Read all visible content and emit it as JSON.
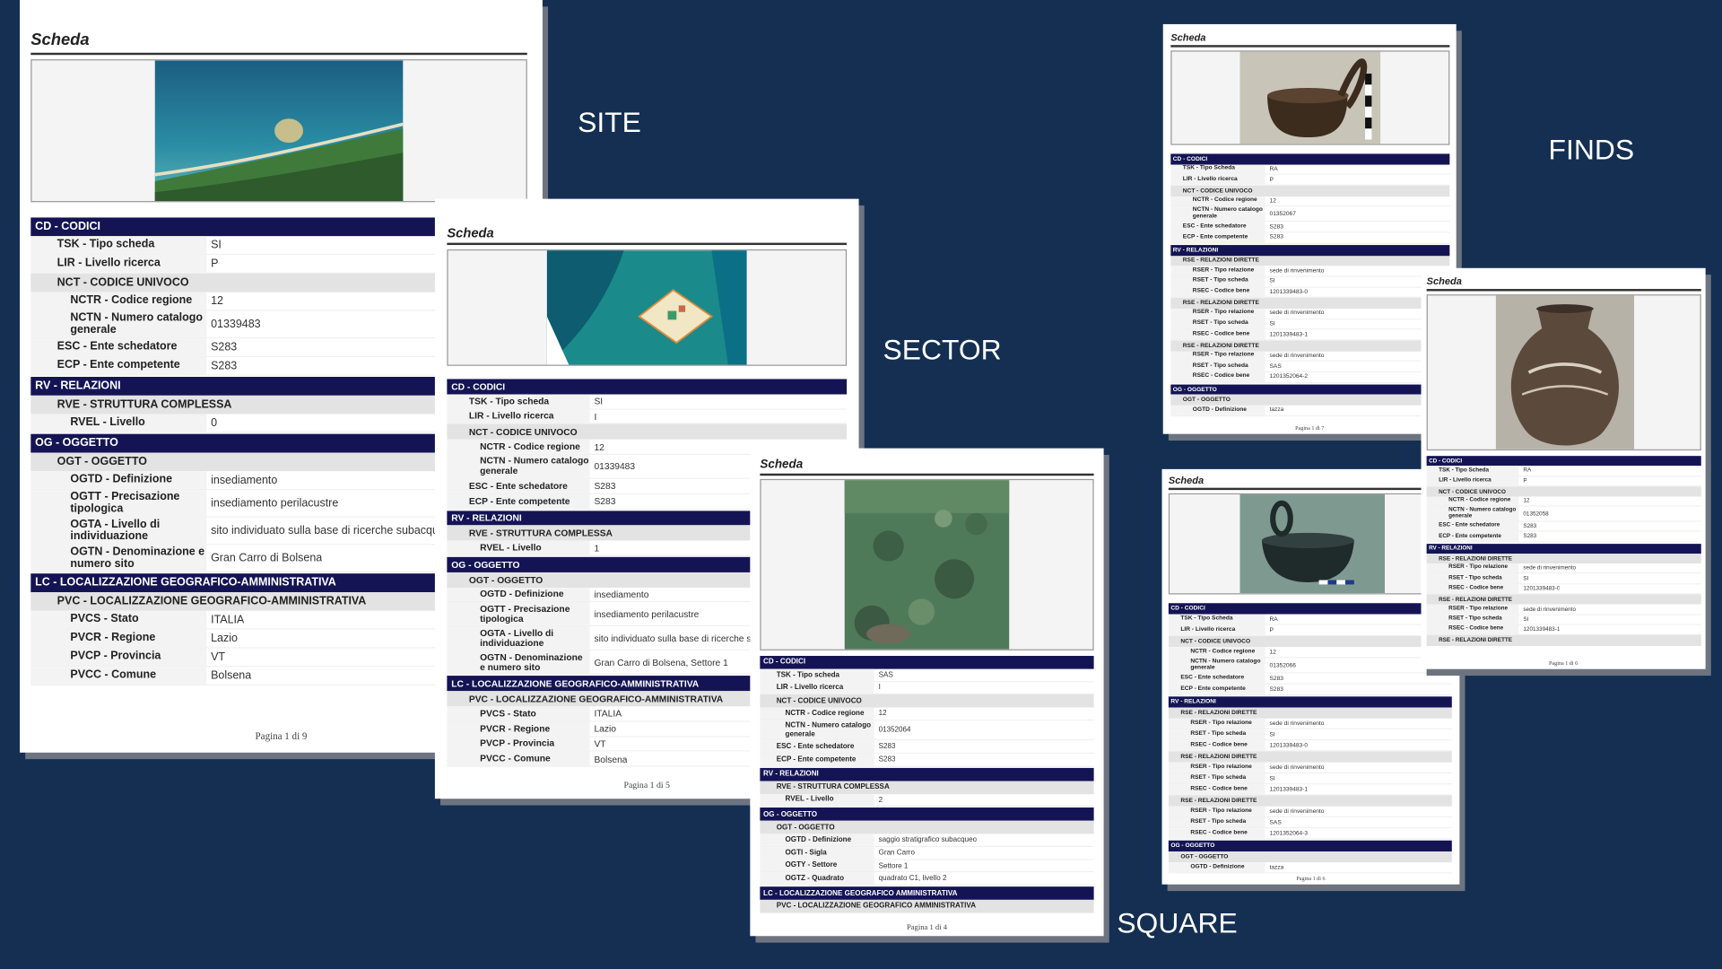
{
  "labels": {
    "site": "SITE",
    "sector": "SECTOR",
    "square": "SQUARE",
    "finds": "FINDS"
  },
  "site": {
    "title": "Scheda",
    "footer": "Pagina 1 di 9",
    "rows": [
      {
        "type": "head",
        "k": "CD - CODICI"
      },
      {
        "type": "leaf",
        "level": 1,
        "k": "TSK - Tipo scheda",
        "v": "SI"
      },
      {
        "type": "leaf",
        "level": 1,
        "k": "LIR - Livello ricerca",
        "v": "P"
      },
      {
        "type": "sub",
        "level": 1,
        "k": "NCT - CODICE UNIVOCO"
      },
      {
        "type": "leaf",
        "level": 2,
        "k": "NCTR - Codice regione",
        "v": "12"
      },
      {
        "type": "leaf",
        "level": 2,
        "k": "NCTN - Numero catalogo generale",
        "v": "01339483",
        "tall": true
      },
      {
        "type": "leaf",
        "level": 1,
        "k": "ESC - Ente schedatore",
        "v": "S283"
      },
      {
        "type": "leaf",
        "level": 1,
        "k": "ECP - Ente competente",
        "v": "S283"
      },
      {
        "type": "head",
        "k": "RV - RELAZIONI"
      },
      {
        "type": "sub",
        "level": 1,
        "k": "RVE - STRUTTURA COMPLESSA"
      },
      {
        "type": "leaf",
        "level": 2,
        "k": "RVEL - Livello",
        "v": "0"
      },
      {
        "type": "head",
        "k": "OG - OGGETTO"
      },
      {
        "type": "sub",
        "level": 1,
        "k": "OGT - OGGETTO"
      },
      {
        "type": "leaf",
        "level": 2,
        "k": "OGTD - Definizione",
        "v": "insediamento"
      },
      {
        "type": "leaf",
        "level": 2,
        "k": "OGTT - Precisazione tipologica",
        "v": "insediamento perilacustre",
        "tall": true
      },
      {
        "type": "leaf",
        "level": 2,
        "k": "OGTA - Livello di individuazione",
        "v": "sito individuato sulla base di ricerche subacque",
        "tall": true
      },
      {
        "type": "leaf",
        "level": 2,
        "k": "OGTN - Denominazione e numero sito",
        "v": "Gran Carro di Bolsena",
        "tall": true
      },
      {
        "type": "head",
        "k": "LC - LOCALIZZAZIONE GEOGRAFICO-AMMINISTRATIVA"
      },
      {
        "type": "sub",
        "level": 1,
        "k": "PVC - LOCALIZZAZIONE GEOGRAFICO-AMMINISTRATIVA"
      },
      {
        "type": "leaf",
        "level": 2,
        "k": "PVCS - Stato",
        "v": "ITALIA"
      },
      {
        "type": "leaf",
        "level": 2,
        "k": "PVCR - Regione",
        "v": "Lazio"
      },
      {
        "type": "leaf",
        "level": 2,
        "k": "PVCP - Provincia",
        "v": "VT"
      },
      {
        "type": "leaf",
        "level": 2,
        "k": "PVCC - Comune",
        "v": "Bolsena"
      }
    ]
  },
  "sector": {
    "title": "Scheda",
    "footer": "Pagina 1 di 5",
    "rows": [
      {
        "type": "head",
        "k": "CD - CODICI"
      },
      {
        "type": "leaf",
        "level": 1,
        "k": "TSK - Tipo scheda",
        "v": "SI"
      },
      {
        "type": "leaf",
        "level": 1,
        "k": "LIR - Livello ricerca",
        "v": "I"
      },
      {
        "type": "sub",
        "level": 1,
        "k": "NCT - CODICE UNIVOCO"
      },
      {
        "type": "leaf",
        "level": 2,
        "k": "NCTR - Codice regione",
        "v": "12"
      },
      {
        "type": "leaf",
        "level": 2,
        "k": "NCTN - Numero catalogo generale",
        "v": "01339483",
        "tall": true
      },
      {
        "type": "leaf",
        "level": 1,
        "k": "ESC - Ente schedatore",
        "v": "S283"
      },
      {
        "type": "leaf",
        "level": 1,
        "k": "ECP - Ente competente",
        "v": "S283"
      },
      {
        "type": "head",
        "k": "RV - RELAZIONI"
      },
      {
        "type": "sub",
        "level": 1,
        "k": "RVE - STRUTTURA COMPLESSA"
      },
      {
        "type": "leaf",
        "level": 2,
        "k": "RVEL - Livello",
        "v": "1"
      },
      {
        "type": "head",
        "k": "OG - OGGETTO"
      },
      {
        "type": "sub",
        "level": 1,
        "k": "OGT - OGGETTO"
      },
      {
        "type": "leaf",
        "level": 2,
        "k": "OGTD - Definizione",
        "v": "insediamento"
      },
      {
        "type": "leaf",
        "level": 2,
        "k": "OGTT - Precisazione tipologica",
        "v": "insediamento perilacustre",
        "tall": true
      },
      {
        "type": "leaf",
        "level": 2,
        "k": "OGTA - Livello di individuazione",
        "v": "sito individuato sulla base di ricerche sub",
        "tall": true
      },
      {
        "type": "leaf",
        "level": 2,
        "k": "OGTN - Denominazione e numero sito",
        "v": "Gran Carro di Bolsena, Settore 1",
        "tall": true
      },
      {
        "type": "head",
        "k": "LC - LOCALIZZAZIONE GEOGRAFICO-AMMINISTRATIVA"
      },
      {
        "type": "sub",
        "level": 1,
        "k": "PVC - LOCALIZZAZIONE GEOGRAFICO-AMMINISTRATIVA"
      },
      {
        "type": "leaf",
        "level": 2,
        "k": "PVCS - Stato",
        "v": "ITALIA"
      },
      {
        "type": "leaf",
        "level": 2,
        "k": "PVCR - Regione",
        "v": "Lazio"
      },
      {
        "type": "leaf",
        "level": 2,
        "k": "PVCP - Provincia",
        "v": "VT"
      },
      {
        "type": "leaf",
        "level": 2,
        "k": "PVCC - Comune",
        "v": "Bolsena"
      }
    ]
  },
  "square": {
    "title": "Scheda",
    "footer": "Pagina 1 di 4",
    "rows": [
      {
        "type": "head",
        "k": "CD - CODICI"
      },
      {
        "type": "leaf",
        "level": 1,
        "k": "TSK - Tipo scheda",
        "v": "SAS"
      },
      {
        "type": "leaf",
        "level": 1,
        "k": "LIR - Livello ricerca",
        "v": "I"
      },
      {
        "type": "sub",
        "level": 1,
        "k": "NCT - CODICE UNIVOCO"
      },
      {
        "type": "leaf",
        "level": 2,
        "k": "NCTR - Codice regione",
        "v": "12"
      },
      {
        "type": "leaf",
        "level": 2,
        "k": "NCTN - Numero catalogo generale",
        "v": "01352064",
        "tall": true
      },
      {
        "type": "leaf",
        "level": 1,
        "k": "ESC - Ente schedatore",
        "v": "S283"
      },
      {
        "type": "leaf",
        "level": 1,
        "k": "ECP - Ente competente",
        "v": "S283"
      },
      {
        "type": "head",
        "k": "RV - RELAZIONI"
      },
      {
        "type": "sub",
        "level": 1,
        "k": "RVE - STRUTTURA COMPLESSA"
      },
      {
        "type": "leaf",
        "level": 2,
        "k": "RVEL - Livello",
        "v": "2"
      },
      {
        "type": "head",
        "k": "OG - OGGETTO"
      },
      {
        "type": "sub",
        "level": 1,
        "k": "OGT - OGGETTO"
      },
      {
        "type": "leaf",
        "level": 2,
        "k": "OGTD - Definizione",
        "v": "saggio stratigrafico subacqueo"
      },
      {
        "type": "leaf",
        "level": 2,
        "k": "OGTI - Sigla",
        "v": "Gran Carro"
      },
      {
        "type": "leaf",
        "level": 2,
        "k": "OGTY - Settore",
        "v": "Settore 1"
      },
      {
        "type": "leaf",
        "level": 2,
        "k": "OGTZ - Quadrato",
        "v": "quadrato C1, livello 2"
      },
      {
        "type": "head",
        "k": "LC - LOCALIZZAZIONE GEOGRAFICO AMMINISTRATIVA"
      },
      {
        "type": "sub",
        "level": 1,
        "k": "PVC - LOCALIZZAZIONE GEOGRAFICO AMMINISTRATIVA"
      }
    ]
  },
  "find1": {
    "title": "Scheda",
    "footer": "Pagina 1 di 7",
    "rows": [
      {
        "type": "head",
        "k": "CD - CODICI"
      },
      {
        "type": "leaf",
        "level": 1,
        "k": "TSK - Tipo Scheda",
        "v": "RA"
      },
      {
        "type": "leaf",
        "level": 1,
        "k": "LIR - Livello ricerca",
        "v": "P"
      },
      {
        "type": "sub",
        "level": 1,
        "k": "NCT - CODICE UNIVOCO"
      },
      {
        "type": "leaf",
        "level": 2,
        "k": "NCTR - Codice regione",
        "v": "12"
      },
      {
        "type": "leaf",
        "level": 2,
        "k": "NCTN - Numero catalogo generale",
        "v": "01352067",
        "tall": true
      },
      {
        "type": "leaf",
        "level": 1,
        "k": "ESC - Ente schedatore",
        "v": "S283"
      },
      {
        "type": "leaf",
        "level": 1,
        "k": "ECP - Ente competente",
        "v": "S283"
      },
      {
        "type": "head",
        "k": "RV - RELAZIONI"
      },
      {
        "type": "sub",
        "level": 1,
        "k": "RSE - RELAZIONI DIRETTE"
      },
      {
        "type": "leaf",
        "level": 2,
        "k": "RSER - Tipo relazione",
        "v": "sede di rinvenimento"
      },
      {
        "type": "leaf",
        "level": 2,
        "k": "RSET - Tipo scheda",
        "v": "SI"
      },
      {
        "type": "leaf",
        "level": 2,
        "k": "RSEC - Codice bene",
        "v": "1201339483-0"
      },
      {
        "type": "sub",
        "level": 1,
        "k": "RSE - RELAZIONI DIRETTE"
      },
      {
        "type": "leaf",
        "level": 2,
        "k": "RSER - Tipo relazione",
        "v": "sede di rinvenimento"
      },
      {
        "type": "leaf",
        "level": 2,
        "k": "RSET - Tipo scheda",
        "v": "SI"
      },
      {
        "type": "leaf",
        "level": 2,
        "k": "RSEC - Codice bene",
        "v": "1201339483-1"
      },
      {
        "type": "sub",
        "level": 1,
        "k": "RSE - RELAZIONI DIRETTE"
      },
      {
        "type": "leaf",
        "level": 2,
        "k": "RSER - Tipo relazione",
        "v": "sede di rinvenimento"
      },
      {
        "type": "leaf",
        "level": 2,
        "k": "RSET - Tipo scheda",
        "v": "SAS"
      },
      {
        "type": "leaf",
        "level": 2,
        "k": "RSEC - Codice bene",
        "v": "1201352064-2"
      },
      {
        "type": "head",
        "k": "OG - OGGETTO"
      },
      {
        "type": "sub",
        "level": 1,
        "k": "OGT - OGGETTO"
      },
      {
        "type": "leaf",
        "level": 2,
        "k": "OGTD - Definizione",
        "v": "tazza"
      }
    ]
  },
  "find2": {
    "title": "Scheda",
    "footer": "Pagina 1 di 6",
    "rows": [
      {
        "type": "head",
        "k": "CD - CODICI"
      },
      {
        "type": "leaf",
        "level": 1,
        "k": "TSK - Tipo Scheda",
        "v": "RA"
      },
      {
        "type": "leaf",
        "level": 1,
        "k": "LIR - Livello ricerca",
        "v": "P"
      },
      {
        "type": "sub",
        "level": 1,
        "k": "NCT - CODICE UNIVOCO"
      },
      {
        "type": "leaf",
        "level": 2,
        "k": "NCTR - Codice regione",
        "v": "12"
      },
      {
        "type": "leaf",
        "level": 2,
        "k": "NCTN - Numero catalogo generale",
        "v": "01352058",
        "tall": true
      },
      {
        "type": "leaf",
        "level": 1,
        "k": "ESC - Ente schedatore",
        "v": "S283"
      },
      {
        "type": "leaf",
        "level": 1,
        "k": "ECP - Ente competente",
        "v": "S283"
      },
      {
        "type": "head",
        "k": "RV - RELAZIONI"
      },
      {
        "type": "sub",
        "level": 1,
        "k": "RSE - RELAZIONI DIRETTE"
      },
      {
        "type": "leaf",
        "level": 2,
        "k": "RSER - Tipo relazione",
        "v": "sede di rinvenimento"
      },
      {
        "type": "leaf",
        "level": 2,
        "k": "RSET - Tipo scheda",
        "v": "SI"
      },
      {
        "type": "leaf",
        "level": 2,
        "k": "RSEC - Codice bene",
        "v": "1201339483-0"
      },
      {
        "type": "sub",
        "level": 1,
        "k": "RSE - RELAZIONI DIRETTE"
      },
      {
        "type": "leaf",
        "level": 2,
        "k": "RSER - Tipo relazione",
        "v": "sede di rinvenimento"
      },
      {
        "type": "leaf",
        "level": 2,
        "k": "RSET - Tipo scheda",
        "v": "SI"
      },
      {
        "type": "leaf",
        "level": 2,
        "k": "RSEC - Codice bene",
        "v": "1201339483-1"
      },
      {
        "type": "sub",
        "level": 1,
        "k": "RSE - RELAZIONI DIRETTE"
      }
    ]
  },
  "find3": {
    "title": "Scheda",
    "footer": "Pagina 1 di 6",
    "rows": [
      {
        "type": "head",
        "k": "CD - CODICI"
      },
      {
        "type": "leaf",
        "level": 1,
        "k": "TSK - Tipo Scheda",
        "v": "RA"
      },
      {
        "type": "leaf",
        "level": 1,
        "k": "LIR - Livello ricerca",
        "v": "P"
      },
      {
        "type": "sub",
        "level": 1,
        "k": "NCT - CODICE UNIVOCO"
      },
      {
        "type": "leaf",
        "level": 2,
        "k": "NCTR - Codice regione",
        "v": "12"
      },
      {
        "type": "leaf",
        "level": 2,
        "k": "NCTN - Numero catalogo generale",
        "v": "01352066",
        "tall": true
      },
      {
        "type": "leaf",
        "level": 1,
        "k": "ESC - Ente schedatore",
        "v": "S283"
      },
      {
        "type": "leaf",
        "level": 1,
        "k": "ECP - Ente competente",
        "v": "S283"
      },
      {
        "type": "head",
        "k": "RV - RELAZIONI"
      },
      {
        "type": "sub",
        "level": 1,
        "k": "RSE - RELAZIONI DIRETTE"
      },
      {
        "type": "leaf",
        "level": 2,
        "k": "RSER - Tipo relazione",
        "v": "sede di rinvenimento"
      },
      {
        "type": "leaf",
        "level": 2,
        "k": "RSET - Tipo scheda",
        "v": "SI"
      },
      {
        "type": "leaf",
        "level": 2,
        "k": "RSEC - Codice bene",
        "v": "1201339483-0"
      },
      {
        "type": "sub",
        "level": 1,
        "k": "RSE - RELAZIONI DIRETTE"
      },
      {
        "type": "leaf",
        "level": 2,
        "k": "RSER - Tipo relazione",
        "v": "sede di rinvenimento"
      },
      {
        "type": "leaf",
        "level": 2,
        "k": "RSET - Tipo scheda",
        "v": "SI"
      },
      {
        "type": "leaf",
        "level": 2,
        "k": "RSEC - Codice bene",
        "v": "1201339483-1"
      },
      {
        "type": "sub",
        "level": 1,
        "k": "RSE - RELAZIONI DIRETTE"
      },
      {
        "type": "leaf",
        "level": 2,
        "k": "RSER - Tipo relazione",
        "v": "sede di rinvenimento"
      },
      {
        "type": "leaf",
        "level": 2,
        "k": "RSET - Tipo scheda",
        "v": "SAS"
      },
      {
        "type": "leaf",
        "level": 2,
        "k": "RSEC - Codice bene",
        "v": "1201352064-3"
      },
      {
        "type": "head",
        "k": "OG - OGGETTO"
      },
      {
        "type": "sub",
        "level": 1,
        "k": "OGT - OGGETTO"
      },
      {
        "type": "leaf",
        "level": 2,
        "k": "OGTD - Definizione",
        "v": "tazza"
      }
    ]
  }
}
